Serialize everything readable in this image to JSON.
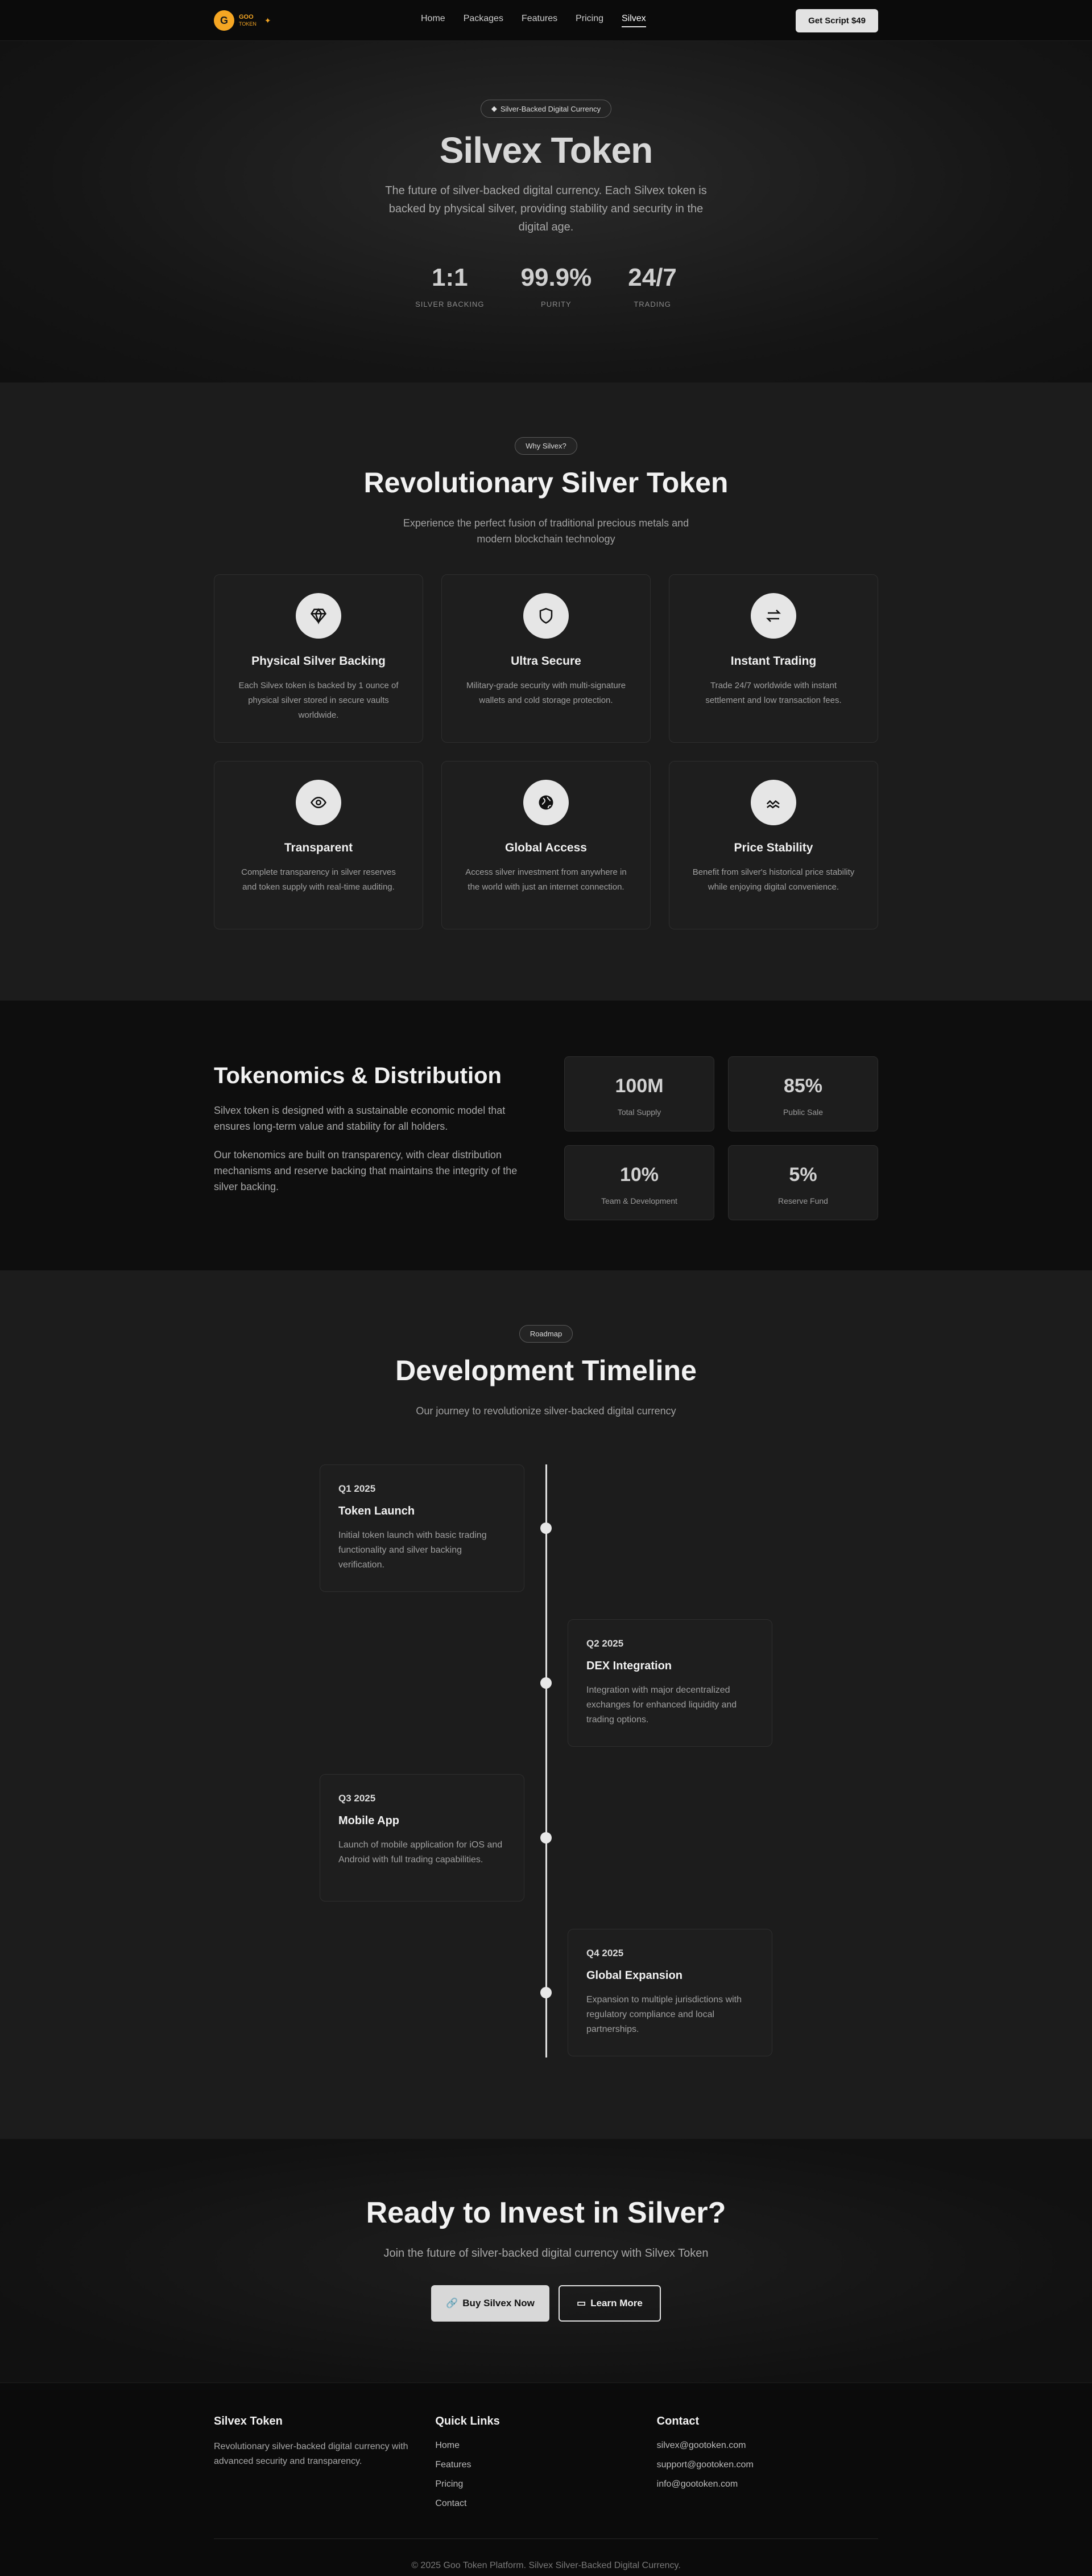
{
  "nav": {
    "logo_letter": "G",
    "logo_line1": "GOO",
    "logo_line2": "TOKEN",
    "links": [
      "Home",
      "Packages",
      "Features",
      "Pricing",
      "Silvex"
    ],
    "active_link": "Silvex",
    "cta_label": "Get Script $49"
  },
  "hero": {
    "badge": "Silver-Backed Digital Currency",
    "title": "Silvex Token",
    "lead": "The future of silver-backed digital currency. Each Silvex token is backed by physical silver, providing stability and security in the digital age.",
    "stats": [
      {
        "value": "1:1",
        "label": "SILVER BACKING"
      },
      {
        "value": "99.9%",
        "label": "PURITY"
      },
      {
        "value": "24/7",
        "label": "TRADING"
      }
    ]
  },
  "features": {
    "badge": "Why Silvex?",
    "title": "Revolutionary Silver Token",
    "subtitle": "Experience the perfect fusion of traditional precious metals and modern blockchain technology",
    "items": [
      {
        "icon": "diamond-icon",
        "title": "Physical Silver Backing",
        "text": "Each Silvex token is backed by 1 ounce of physical silver stored in secure vaults worldwide."
      },
      {
        "icon": "shield-icon",
        "title": "Ultra Secure",
        "text": "Military-grade security with multi-signature wallets and cold storage protection."
      },
      {
        "icon": "exchange-icon",
        "title": "Instant Trading",
        "text": "Trade 24/7 worldwide with instant settlement and low transaction fees."
      },
      {
        "icon": "eye-icon",
        "title": "Transparent",
        "text": "Complete transparency in silver reserves and token supply with real-time auditing."
      },
      {
        "icon": "globe-icon",
        "title": "Global Access",
        "text": "Access silver investment from anywhere in the world with just an internet connection."
      },
      {
        "icon": "chart-line-icon",
        "title": "Price Stability",
        "text": "Benefit from silver's historical price stability while enjoying digital convenience."
      }
    ]
  },
  "tokenomics": {
    "title": "Tokenomics & Distribution",
    "para1": "Silvex token is designed with a sustainable economic model that ensures long-term value and stability for all holders.",
    "para2": "Our tokenomics are built on transparency, with clear distribution mechanisms and reserve backing that maintains the integrity of the silver backing.",
    "cards": [
      {
        "value": "100M",
        "label": "Total Supply"
      },
      {
        "value": "85%",
        "label": "Public Sale"
      },
      {
        "value": "10%",
        "label": "Team & Development"
      },
      {
        "value": "5%",
        "label": "Reserve Fund"
      }
    ]
  },
  "roadmap": {
    "badge": "Roadmap",
    "title": "Development Timeline",
    "subtitle": "Our journey to revolutionize silver-backed digital currency",
    "items": [
      {
        "quarter": "Q1 2025",
        "title": "Token Launch",
        "text": "Initial token launch with basic trading functionality and silver backing verification."
      },
      {
        "quarter": "Q2 2025",
        "title": "DEX Integration",
        "text": "Integration with major decentralized exchanges for enhanced liquidity and trading options."
      },
      {
        "quarter": "Q3 2025",
        "title": "Mobile App",
        "text": "Launch of mobile application for iOS and Android with full trading capabilities."
      },
      {
        "quarter": "Q4 2025",
        "title": "Global Expansion",
        "text": "Expansion to multiple jurisdictions with regulatory compliance and local partnerships."
      }
    ]
  },
  "cta": {
    "title": "Ready to Invest in Silver?",
    "subtitle": "Join the future of silver-backed digital currency with Silvex Token",
    "primary_label": "Buy Silvex Now",
    "secondary_label": "Learn More"
  },
  "footer": {
    "brand_title": "Silvex Token",
    "brand_text": "Revolutionary silver-backed digital currency with advanced security and transparency.",
    "links_title": "Quick Links",
    "links": [
      "Home",
      "Features",
      "Pricing",
      "Contact"
    ],
    "contact_title": "Contact",
    "contacts": [
      "silvex@gootoken.com",
      "support@gootoken.com",
      "info@gootoken.com"
    ],
    "copyright": "© 2025 Goo Token Platform. Silvex Silver-Backed Digital Currency."
  }
}
